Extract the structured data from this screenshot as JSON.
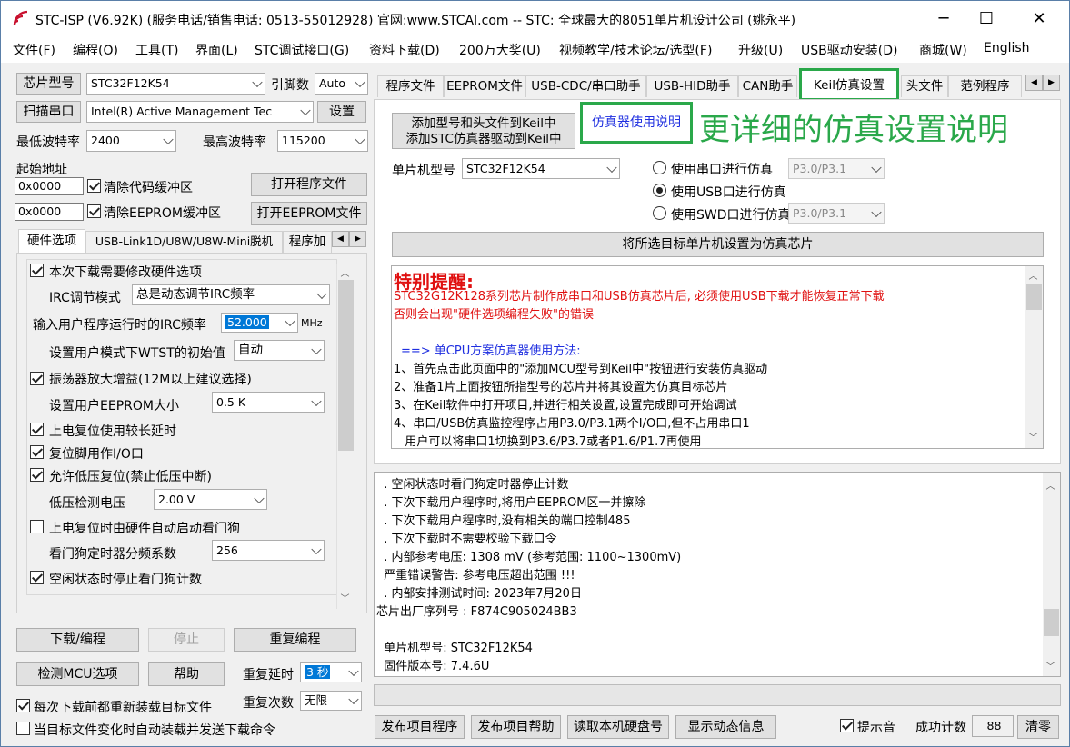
{
  "window": {
    "title": "STC-ISP (V6.92K) (服务电话/销售电话: 0513-55012928) 官网:www.STCAI.com  -- STC: 全球最大的8051单片机设计公司 (姚永平)",
    "app_icon": "stc-wifi-icon",
    "min": "─",
    "max": "☐",
    "close": "✕"
  },
  "menu": [
    "文件(F)",
    "编程(O)",
    "工具(T)",
    "界面(L)",
    "STC调试接口(G)",
    "资料下载(D)",
    "200万大奖(U)",
    "视频教学/技术论坛/选型(F)",
    "升级(U)",
    "USB驱动安装(D)",
    "商城(W)",
    "English"
  ],
  "left": {
    "chip_type_btn": "芯片型号",
    "chip_value": "STC32F12K54",
    "pins_label": "引脚数",
    "pins_value": "Auto",
    "scan_btn": "扫描串口",
    "port_value": "Intel(R) Active Management Tec",
    "settings_btn": "设置",
    "min_baud_label": "最低波特率",
    "min_baud_value": "2400",
    "max_baud_label": "最高波特率",
    "max_baud_value": "115200",
    "start_addr_label": "起始地址",
    "addr1": "0x0000",
    "clear_code": "清除代码缓冲区",
    "open_prog_btn": "打开程序文件",
    "addr2": "0x0000",
    "clear_eeprom": "清除EEPROM缓冲区",
    "open_eeprom_btn": "打开EEPROM文件",
    "tabs": [
      "硬件选项",
      "USB-Link1D/U8W/U8W-Mini脱机",
      "程序加"
    ],
    "hw": {
      "modify_hw": "本次下载需要修改硬件选项",
      "irc_mode_label": "IRC调节模式",
      "irc_mode_value": "总是动态调节IRC频率",
      "irc_freq_label": "输入用户程序运行时的IRC频率",
      "irc_freq_value": "52.000",
      "mhz": "MHz",
      "wtst_label": "设置用户模式下WTST的初始值",
      "wtst_value": "自动",
      "osc_gain": "振荡器放大增益(12M以上建议选择)",
      "eeprom_size_label": "设置用户EEPROM大小",
      "eeprom_size_value": "0.5 K",
      "long_reset": "上电复位使用较长延时",
      "reset_io": "复位脚用作I/O口",
      "lvd_reset": "允许低压复位(禁止低压中断)",
      "lvd_label": "低压检测电压",
      "lvd_value": "2.00 V",
      "wdt_auto": "上电复位时由硬件自动启动看门狗",
      "wdt_div_label": "看门狗定时器分频系数",
      "wdt_div_value": "256",
      "idle_wdt": "空闲状态时停止看门狗计数"
    },
    "download_btn": "下载/编程",
    "stop_btn": "停止",
    "reprog_btn": "重复编程",
    "detect_btn": "检测MCU选项",
    "help_btn": "帮助",
    "repeat_delay_label": "重复延时",
    "repeat_delay_value": "3 秒",
    "repeat_count_label": "重复次数",
    "repeat_count_value": "无限",
    "reload_each": "每次下载前都重新装载目标文件",
    "auto_reload": "当目标文件变化时自动装载并发送下载命令"
  },
  "right": {
    "tabs": [
      "程序文件",
      "EEPROM文件",
      "USB-CDC/串口助手",
      "USB-HID助手",
      "CAN助手",
      "Keil仿真设置",
      "头文件",
      "范例程序"
    ],
    "active_tab": 5,
    "add_btn_line1": "添加型号和头文件到Keil中",
    "add_btn_line2": "添加STC仿真器驱动到Keil中",
    "emu_help_btn": "仿真器使用说明",
    "annotation": "更详细的仿真设置说明",
    "annotation_color": "#2aa84a",
    "mcu_label": "单片机型号",
    "mcu_value": "STC32F12K54",
    "r_serial": "使用串口进行仿真",
    "r_serial_port": "P3.0/P3.1",
    "r_usb": "使用USB口进行仿真",
    "r_swd": "使用SWD口进行仿真",
    "r_swd_port": "P3.0/P3.1",
    "set_emu_btn": "将所选目标单片机设置为仿真芯片",
    "info": {
      "heading": "特别提醒:",
      "red1": "STC32G12K128系列芯片制作成串口和USB仿真芯片后, 必须使用USB下载才能恢复正常下载",
      "red2": "否则会出现\"硬件选项编程失败\"的错误",
      "blue1": "==> 单CPU方案仿真器使用方法:",
      "l1": "1、首先点击此页面中的\"添加MCU型号到Keil中\"按钮进行安装仿真驱动",
      "l2": "2、准备1片上面按钮所指型号的芯片并将其设置为仿真目标芯片",
      "l3": "3、在Keil软件中打开项目,并进行相关设置,设置完成即可开始调试",
      "l4": "4、串口/USB仿真监控程序占用P3.0/P3.1两个I/O口,但不占用串口1",
      "l5": "   用户可以将串口1切换到P3.6/P3.7或者P1.6/P1.7再使用"
    },
    "log": [
      "  . 空闲状态时看门狗定时器停止计数",
      "  . 下次下载用户程序时,将用户EEPROM区一并擦除",
      "  . 下次下载用户程序时,没有相关的端口控制485",
      "  . 下次下载时不需要校验下载口令",
      "  . 内部参考电压: 1308 mV (参考范围: 1100~1300mV)",
      "  严重错误警告: 参考电压超出范围 !!!",
      "  . 内部安排测试时间: 2023年7月20日",
      "芯片出厂序列号 : F874C905024BB3",
      "",
      "  单片机型号: STC32F12K54",
      "  固件版本号: 7.4.6U"
    ],
    "publish_btn": "发布项目程序",
    "publish_help_btn": "发布项目帮助",
    "read_disk_btn": "读取本机硬盘号",
    "show_info_btn": "显示动态信息",
    "beep": "提示音",
    "success_label": "成功计数",
    "success_value": "88",
    "clear_btn": "清零"
  }
}
